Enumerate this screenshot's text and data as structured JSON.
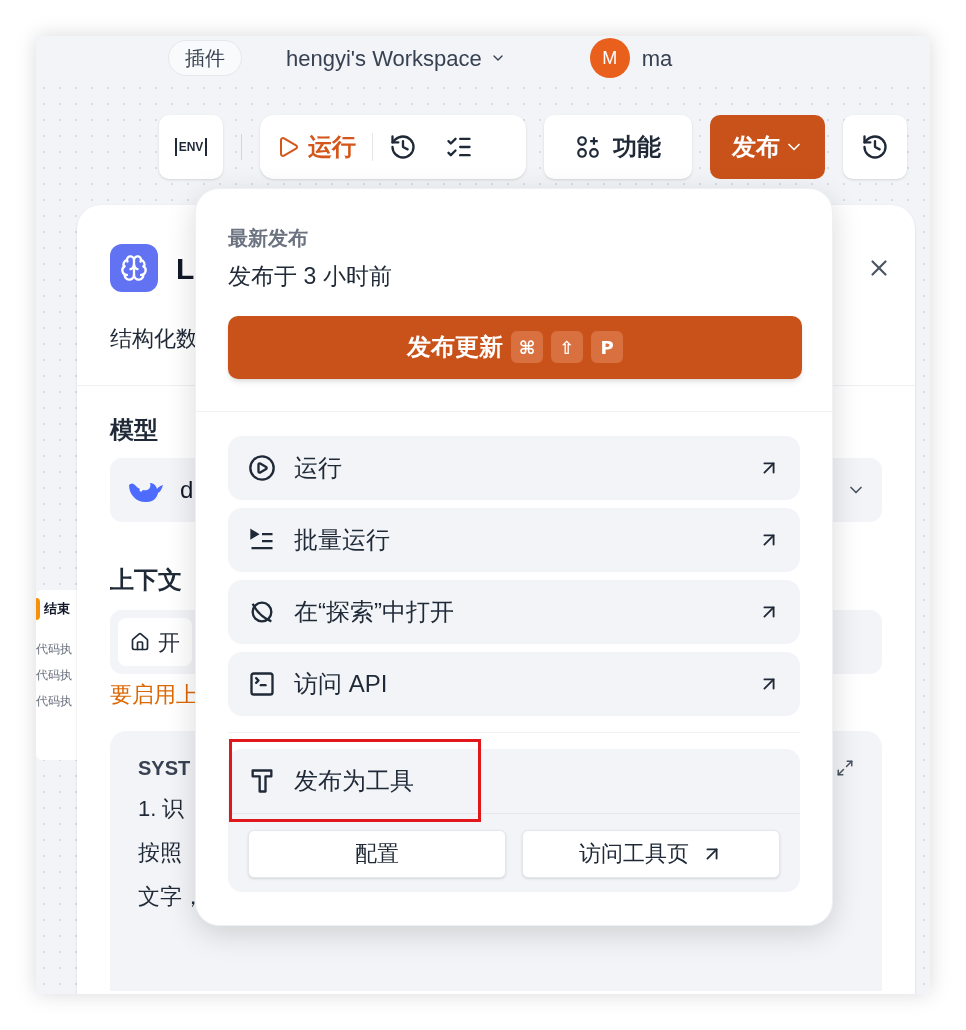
{
  "header": {
    "plugins_label": "插件",
    "workspace": "hengyi's Workspace",
    "avatar_letter": "M",
    "user": "ma"
  },
  "toolbar": {
    "env": "ENV",
    "run": "运行",
    "features": "功能",
    "publish": "发布"
  },
  "side_node": {
    "title": "结束",
    "lines": [
      "代码执",
      "代码执",
      "代码执"
    ]
  },
  "node_panel": {
    "title": "L",
    "description": "结构化数",
    "model_label": "模型",
    "model_value": "d",
    "context_label": "上下文",
    "context_chip": "开",
    "context_warning": "要启用上",
    "system_label": "SYST",
    "system_lines": [
      "1. 识",
      "按照",
      "文字，"
    ]
  },
  "publish_menu": {
    "section_label": "最新发布",
    "published": "发布于 3 小时前",
    "update_button": "发布更新",
    "shortcut_keys": [
      "⌘",
      "⇧",
      "P"
    ],
    "actions": [
      {
        "kind": "run",
        "label": "运行"
      },
      {
        "kind": "batch",
        "label": "批量运行"
      },
      {
        "kind": "explore",
        "label": "在“探索”中打开"
      },
      {
        "kind": "api",
        "label": "访问 API"
      }
    ],
    "tool": {
      "label": "发布为工具",
      "highlighted": true,
      "buttons": [
        {
          "label": "配置",
          "external": false
        },
        {
          "label": "访问工具页",
          "external": true
        }
      ]
    }
  }
}
